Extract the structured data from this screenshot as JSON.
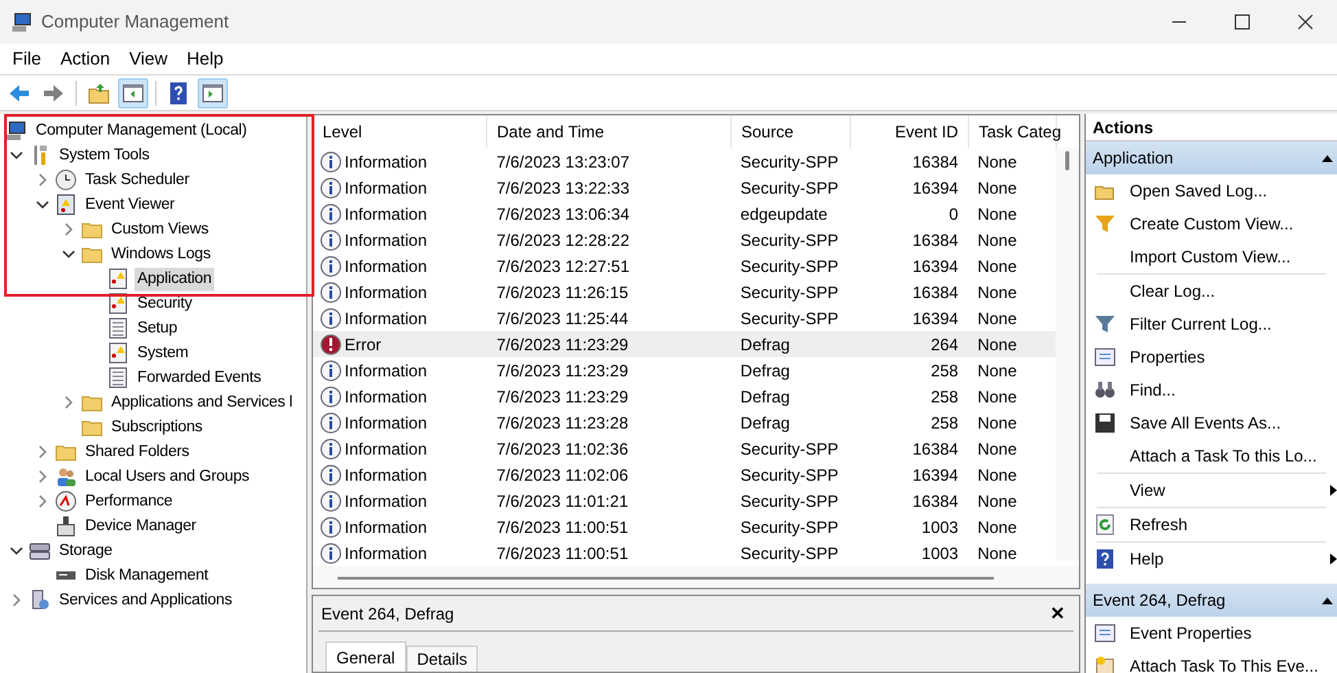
{
  "window": {
    "title": "Computer Management"
  },
  "menu": [
    "File",
    "Action",
    "View",
    "Help"
  ],
  "toolbar": [
    {
      "kind": "back",
      "pressed": false
    },
    {
      "kind": "forward",
      "pressed": false
    },
    {
      "kind": "up",
      "pressed": false
    },
    {
      "kind": "tree",
      "pressed": true
    },
    {
      "kind": "help",
      "pressed": false
    },
    {
      "kind": "pane",
      "pressed": true
    }
  ],
  "tree": [
    {
      "label": "Computer Management (Local)",
      "kind": "computer",
      "selected": false,
      "children": [
        {
          "label": "System Tools",
          "kind": "tools",
          "selected": false,
          "expanded": true,
          "children": [
            {
              "label": "Task Scheduler",
              "kind": "clock",
              "selected": false,
              "expanded": false
            },
            {
              "label": "Event Viewer",
              "kind": "viewer",
              "selected": false,
              "expanded": true,
              "children": [
                {
                  "label": "Custom Views",
                  "kind": "folder",
                  "selected": false,
                  "expanded": false
                },
                {
                  "label": "Windows Logs",
                  "kind": "folder",
                  "selected": false,
                  "expanded": true,
                  "children": [
                    {
                      "label": "Application",
                      "kind": "warnlog",
                      "selected": true
                    },
                    {
                      "label": "Security",
                      "kind": "warnlog",
                      "selected": false
                    },
                    {
                      "label": "Setup",
                      "kind": "log",
                      "selected": false
                    },
                    {
                      "label": "System",
                      "kind": "warnlog",
                      "selected": false
                    },
                    {
                      "label": "Forwarded Events",
                      "kind": "log",
                      "selected": false
                    }
                  ]
                },
                {
                  "label": "Applications and Services l",
                  "kind": "folder",
                  "selected": false,
                  "expanded": false
                },
                {
                  "label": "Subscriptions",
                  "kind": "folder",
                  "selected": false
                }
              ]
            },
            {
              "label": "Shared Folders",
              "kind": "folder",
              "selected": false,
              "expanded": false
            },
            {
              "label": "Local Users and Groups",
              "kind": "users",
              "selected": false,
              "expanded": false
            },
            {
              "label": "Performance",
              "kind": "gauge",
              "selected": false,
              "expanded": false
            },
            {
              "label": "Device Manager",
              "kind": "device",
              "selected": false
            }
          ]
        },
        {
          "label": "Storage",
          "kind": "storage",
          "selected": false,
          "expanded": true,
          "children": [
            {
              "label": "Disk Management",
              "kind": "disk",
              "selected": false
            }
          ]
        },
        {
          "label": "Services and Applications",
          "kind": "services",
          "selected": false,
          "expanded": false
        }
      ]
    }
  ],
  "table": {
    "columns": [
      "Level",
      "Date and Time",
      "Source",
      "Event ID",
      "Task Categ"
    ],
    "rows": [
      {
        "level": "Information",
        "kind": "information",
        "date": "7/6/2023 13:23:07",
        "source": "Security-SPP",
        "event_id": "16384",
        "task": "None",
        "selected": false
      },
      {
        "level": "Information",
        "kind": "information",
        "date": "7/6/2023 13:22:33",
        "source": "Security-SPP",
        "event_id": "16394",
        "task": "None",
        "selected": false
      },
      {
        "level": "Information",
        "kind": "information",
        "date": "7/6/2023 13:06:34",
        "source": "edgeupdate",
        "event_id": "0",
        "task": "None",
        "selected": false
      },
      {
        "level": "Information",
        "kind": "information",
        "date": "7/6/2023 12:28:22",
        "source": "Security-SPP",
        "event_id": "16384",
        "task": "None",
        "selected": false
      },
      {
        "level": "Information",
        "kind": "information",
        "date": "7/6/2023 12:27:51",
        "source": "Security-SPP",
        "event_id": "16394",
        "task": "None",
        "selected": false
      },
      {
        "level": "Information",
        "kind": "information",
        "date": "7/6/2023 11:26:15",
        "source": "Security-SPP",
        "event_id": "16384",
        "task": "None",
        "selected": false
      },
      {
        "level": "Information",
        "kind": "information",
        "date": "7/6/2023 11:25:44",
        "source": "Security-SPP",
        "event_id": "16394",
        "task": "None",
        "selected": false
      },
      {
        "level": "Error",
        "kind": "error",
        "date": "7/6/2023 11:23:29",
        "source": "Defrag",
        "event_id": "264",
        "task": "None",
        "selected": true
      },
      {
        "level": "Information",
        "kind": "information",
        "date": "7/6/2023 11:23:29",
        "source": "Defrag",
        "event_id": "258",
        "task": "None",
        "selected": false
      },
      {
        "level": "Information",
        "kind": "information",
        "date": "7/6/2023 11:23:29",
        "source": "Defrag",
        "event_id": "258",
        "task": "None",
        "selected": false
      },
      {
        "level": "Information",
        "kind": "information",
        "date": "7/6/2023 11:23:28",
        "source": "Defrag",
        "event_id": "258",
        "task": "None",
        "selected": false
      },
      {
        "level": "Information",
        "kind": "information",
        "date": "7/6/2023 11:02:36",
        "source": "Security-SPP",
        "event_id": "16384",
        "task": "None",
        "selected": false
      },
      {
        "level": "Information",
        "kind": "information",
        "date": "7/6/2023 11:02:06",
        "source": "Security-SPP",
        "event_id": "16394",
        "task": "None",
        "selected": false
      },
      {
        "level": "Information",
        "kind": "information",
        "date": "7/6/2023 11:01:21",
        "source": "Security-SPP",
        "event_id": "16384",
        "task": "None",
        "selected": false
      },
      {
        "level": "Information",
        "kind": "information",
        "date": "7/6/2023 11:00:51",
        "source": "Security-SPP",
        "event_id": "1003",
        "task": "None",
        "selected": false
      },
      {
        "level": "Information",
        "kind": "information",
        "date": "7/6/2023 11:00:51",
        "source": "Security-SPP",
        "event_id": "1003",
        "task": "None",
        "selected": false
      }
    ]
  },
  "detail": {
    "title": "Event 264, Defrag",
    "close": "✕",
    "tabs": [
      {
        "label": "General",
        "selected": true
      },
      {
        "label": "Details",
        "selected": false
      }
    ]
  },
  "actions": {
    "title": "Actions",
    "sections": [
      {
        "title": "Application",
        "expanded": true,
        "groups": [
          [
            {
              "label": "Open Saved Log...",
              "kind": "open"
            },
            {
              "label": "Create Custom View...",
              "kind": "filter-gold"
            },
            {
              "label": "Import Custom View...",
              "kind": "none"
            }
          ],
          [
            {
              "label": "Clear Log...",
              "kind": "none"
            },
            {
              "label": "Filter Current Log...",
              "kind": "filter"
            },
            {
              "label": "Properties",
              "kind": "props"
            },
            {
              "label": "Find...",
              "kind": "find"
            },
            {
              "label": "Save All Events As...",
              "kind": "save"
            },
            {
              "label": "Attach a Task To this Lo...",
              "kind": "none"
            }
          ],
          [
            {
              "label": "View",
              "kind": "none",
              "submenu": true
            }
          ],
          [
            {
              "label": "Refresh",
              "kind": "refresh"
            }
          ],
          [
            {
              "label": "Help",
              "kind": "help",
              "submenu": true
            }
          ]
        ]
      },
      {
        "title": "Event 264, Defrag",
        "expanded": true,
        "groups": [
          [
            {
              "label": "Event Properties",
              "kind": "props"
            },
            {
              "label": "Attach Task To This Eve...",
              "kind": "task"
            }
          ]
        ]
      }
    ]
  }
}
